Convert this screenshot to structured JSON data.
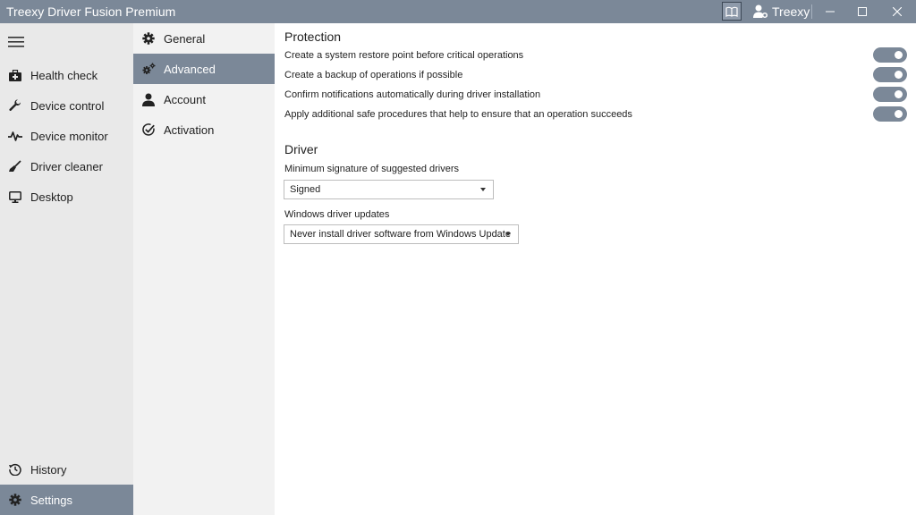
{
  "window": {
    "title": "Treexy Driver Fusion Premium",
    "username": "Treexy"
  },
  "nav": {
    "items": [
      {
        "label": "Health check",
        "icon": "medkit-icon"
      },
      {
        "label": "Device control",
        "icon": "wrench-icon"
      },
      {
        "label": "Device monitor",
        "icon": "pulse-icon"
      },
      {
        "label": "Driver cleaner",
        "icon": "broom-icon"
      },
      {
        "label": "Desktop",
        "icon": "monitor-icon"
      }
    ],
    "bottom_items": [
      {
        "label": "History",
        "icon": "history-icon"
      },
      {
        "label": "Settings",
        "icon": "gear-icon",
        "active": true
      }
    ]
  },
  "settings_nav": {
    "items": [
      {
        "label": "General",
        "icon": "gear-icon"
      },
      {
        "label": "Advanced",
        "icon": "gears-icon",
        "active": true
      },
      {
        "label": "Account",
        "icon": "person-icon"
      },
      {
        "label": "Activation",
        "icon": "check-circle-icon"
      }
    ]
  },
  "protection": {
    "title": "Protection",
    "options": [
      {
        "label": "Create a system restore point before critical operations",
        "enabled": true
      },
      {
        "label": "Create a backup of operations if possible",
        "enabled": true
      },
      {
        "label": "Confirm notifications automatically during driver installation",
        "enabled": true
      },
      {
        "label": "Apply additional safe procedures that help to ensure that an operation succeeds",
        "enabled": true
      }
    ]
  },
  "driver": {
    "title": "Driver",
    "signature_label": "Minimum signature of suggested drivers",
    "signature_value": "Signed",
    "updates_label": "Windows driver updates",
    "updates_value": "Never install driver software from Windows Update"
  },
  "colors": {
    "accent": "#7b8898",
    "nav_background": "#e9e9e9",
    "subnav_background": "#f2f2f2"
  }
}
